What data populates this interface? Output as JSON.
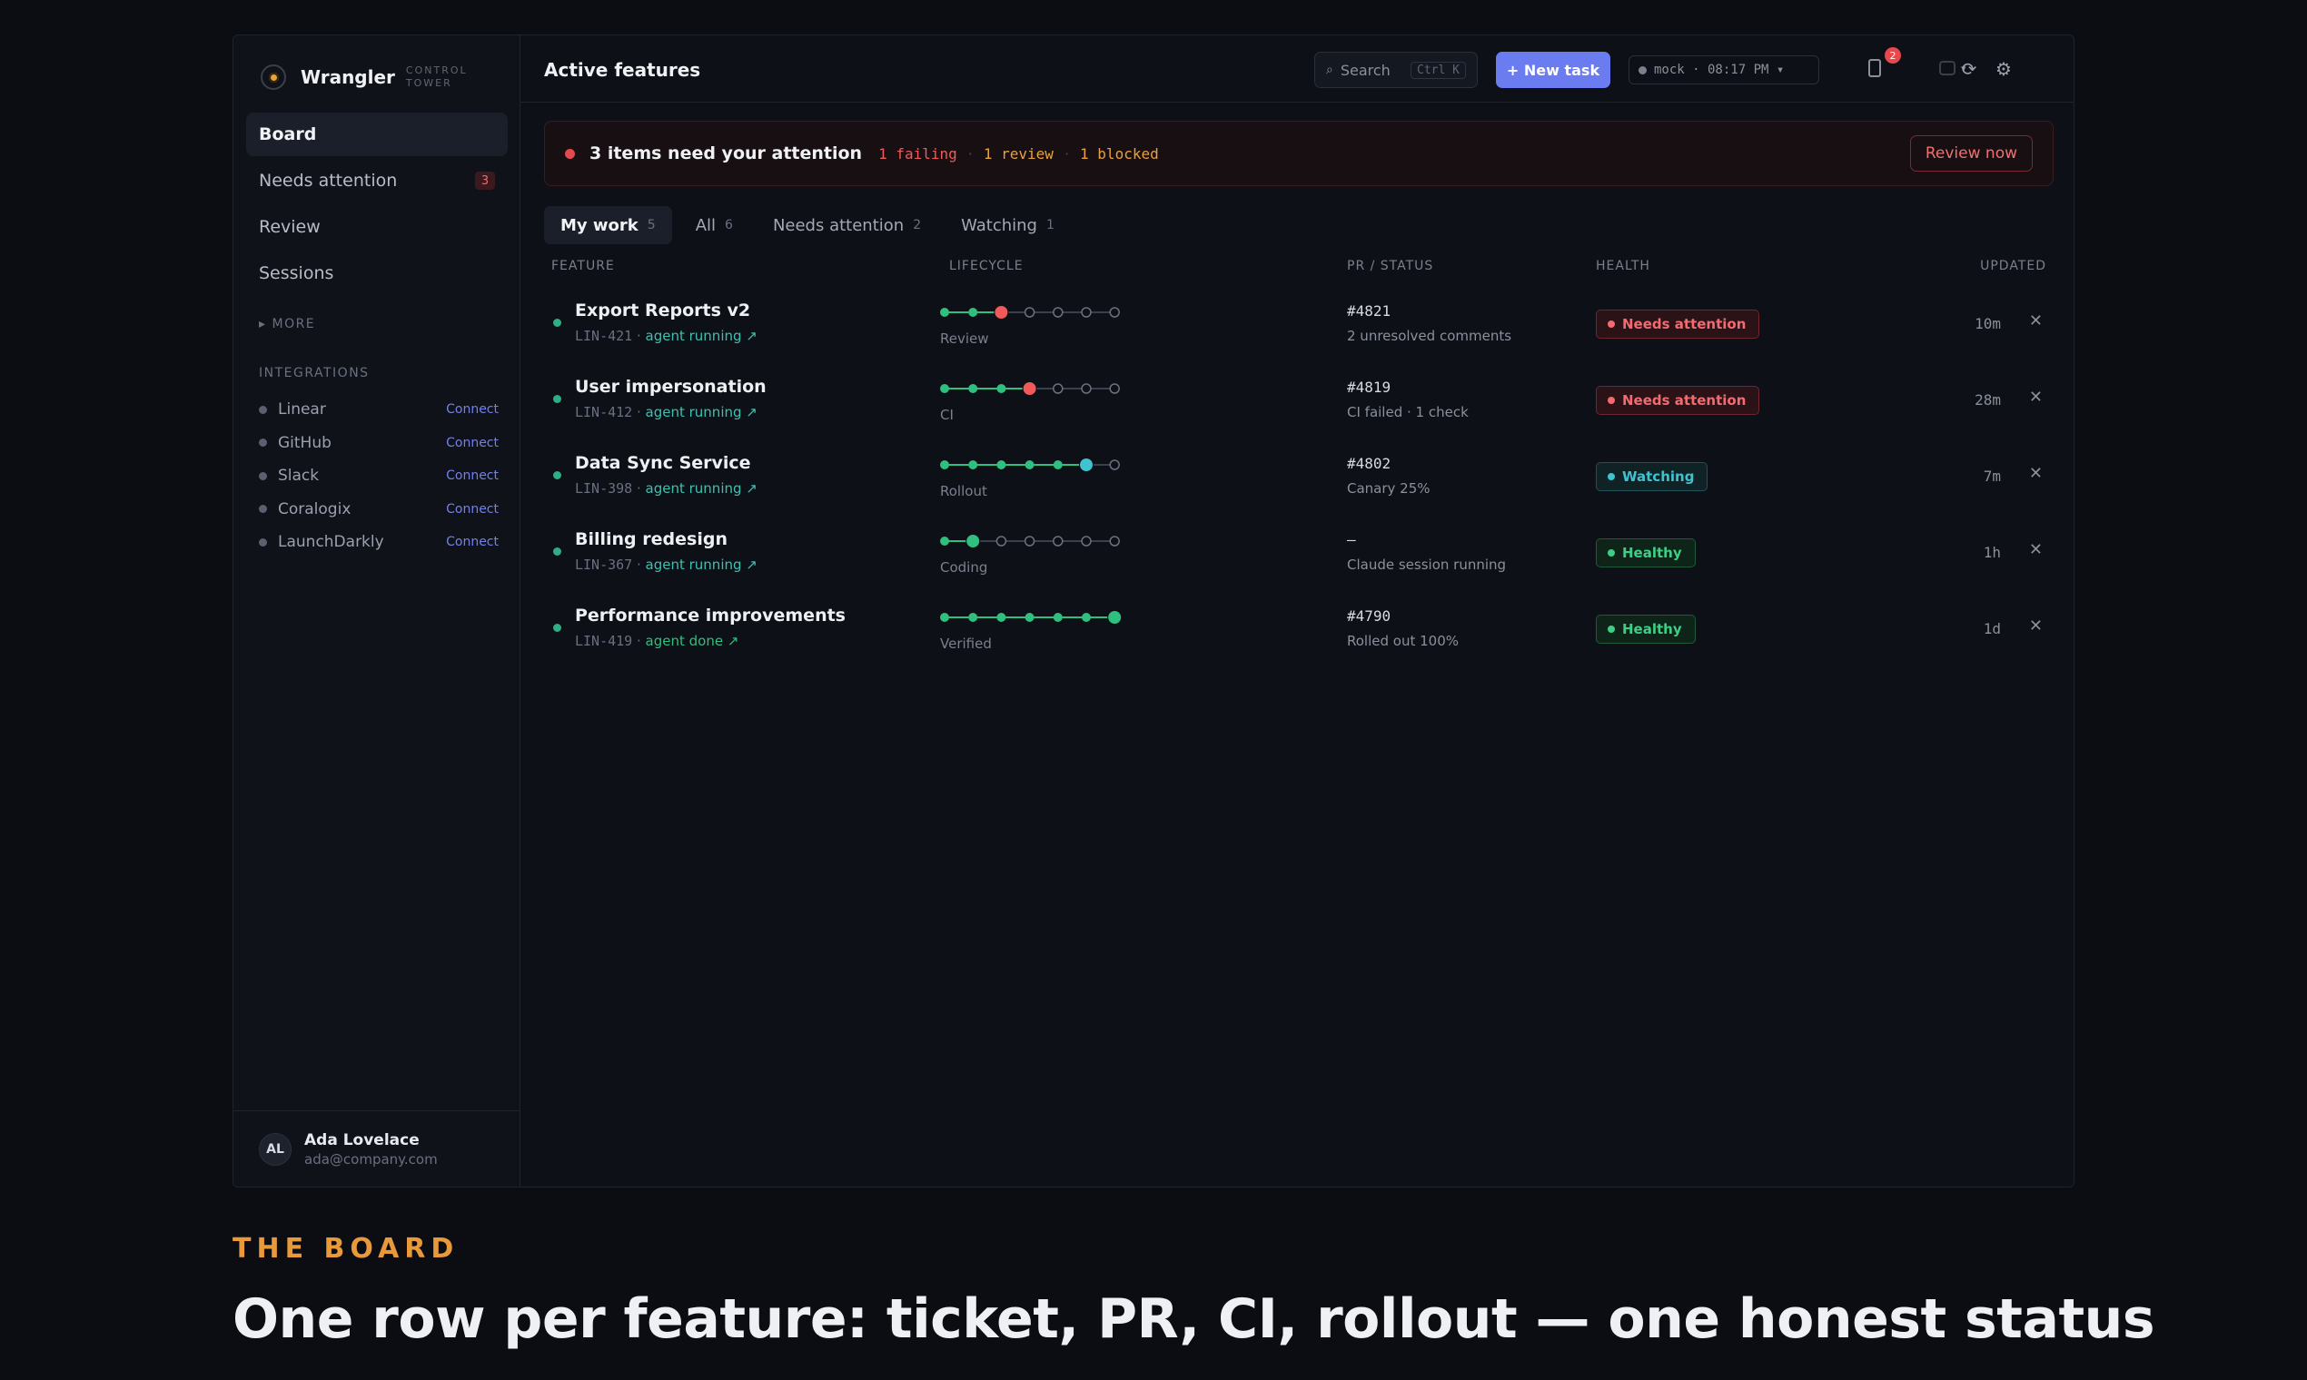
{
  "app": {
    "name": "Wrangler",
    "subtitle": "CONTROL TOWER"
  },
  "sidebar": {
    "items": [
      {
        "label": "Board",
        "active": true
      },
      {
        "label": "Needs attention",
        "badge": "3"
      },
      {
        "label": "Review"
      },
      {
        "label": "Sessions"
      }
    ],
    "more_label": "MORE",
    "integrations_title": "INTEGRATIONS",
    "integrations": [
      {
        "name": "Linear",
        "action": "Connect"
      },
      {
        "name": "GitHub",
        "action": "Connect"
      },
      {
        "name": "Slack",
        "action": "Connect"
      },
      {
        "name": "Coralogix",
        "action": "Connect"
      },
      {
        "name": "LaunchDarkly",
        "action": "Connect"
      }
    ],
    "user": {
      "initials": "AL",
      "name": "Ada Lovelace",
      "email": "ada@company.com"
    }
  },
  "header": {
    "title": "Active features",
    "search_label": "Search",
    "search_shortcut": "Ctrl K",
    "new_task_label": "+ New task",
    "env_label": "mock · 08:17 PM ▾",
    "notification_count": "2",
    "workspace_caret": "▾",
    "refresh_icon": "refresh-icon",
    "settings_icon": "gear-icon"
  },
  "banner": {
    "title": "3 items need your attention",
    "failing": "1 failing",
    "review": "1 review",
    "blocked": "1 blocked",
    "separator": "·",
    "action": "Review now"
  },
  "tabs": [
    {
      "label": "My work",
      "count": "5",
      "active": true
    },
    {
      "label": "All",
      "count": "6"
    },
    {
      "label": "Needs attention",
      "count": "2"
    },
    {
      "label": "Watching",
      "count": "1"
    }
  ],
  "table": {
    "columns": [
      "FEATURE",
      "LIFECYCLE",
      "PR / STATUS",
      "HEALTH",
      "UPDATED"
    ],
    "rows": [
      {
        "name": "Export Reports v2",
        "ticket": "LIN-421",
        "agent": "agent running ↗",
        "agent_done": false,
        "stage_index": 2,
        "stage_state": "fail",
        "stage_label": "Review",
        "pr": "#4821",
        "pr_status": "2 unresolved comments",
        "health": "Needs attention",
        "health_kind": "bad",
        "updated": "10m"
      },
      {
        "name": "User impersonation",
        "ticket": "LIN-412",
        "agent": "agent running ↗",
        "agent_done": false,
        "stage_index": 3,
        "stage_state": "fail",
        "stage_label": "CI",
        "pr": "#4819",
        "pr_status": "CI failed · 1 check",
        "health": "Needs attention",
        "health_kind": "bad",
        "updated": "28m"
      },
      {
        "name": "Data Sync Service",
        "ticket": "LIN-398",
        "agent": "agent running ↗",
        "agent_done": false,
        "stage_index": 5,
        "stage_state": "watch",
        "stage_label": "Rollout",
        "pr": "#4802",
        "pr_status": "Canary 25%",
        "health": "Watching",
        "health_kind": "watch",
        "updated": "7m"
      },
      {
        "name": "Billing redesign",
        "ticket": "LIN-367",
        "agent": "agent running ↗",
        "agent_done": false,
        "stage_index": 1,
        "stage_state": "ok",
        "stage_label": "Coding",
        "pr": "—",
        "pr_status": "Claude session running",
        "health": "Healthy",
        "health_kind": "ok",
        "updated": "1h"
      },
      {
        "name": "Performance improvements",
        "ticket": "LIN-419",
        "agent": "agent done ↗",
        "agent_done": true,
        "stage_index": 6,
        "stage_state": "ok",
        "stage_label": "Verified",
        "pr": "#4790",
        "pr_status": "Rolled out 100%",
        "health": "Healthy",
        "health_kind": "ok",
        "updated": "1d"
      }
    ]
  },
  "footer": {
    "eyebrow": "THE BOARD",
    "headline": "One row per feature: ticket, PR, CI, rollout — one honest status"
  },
  "colors": {
    "accent": "#6b7cf0",
    "ok": "#2fbf7f",
    "fail": "#f05a5a",
    "watch": "#3fc3d1",
    "eyebrow": "#e89a3a"
  }
}
